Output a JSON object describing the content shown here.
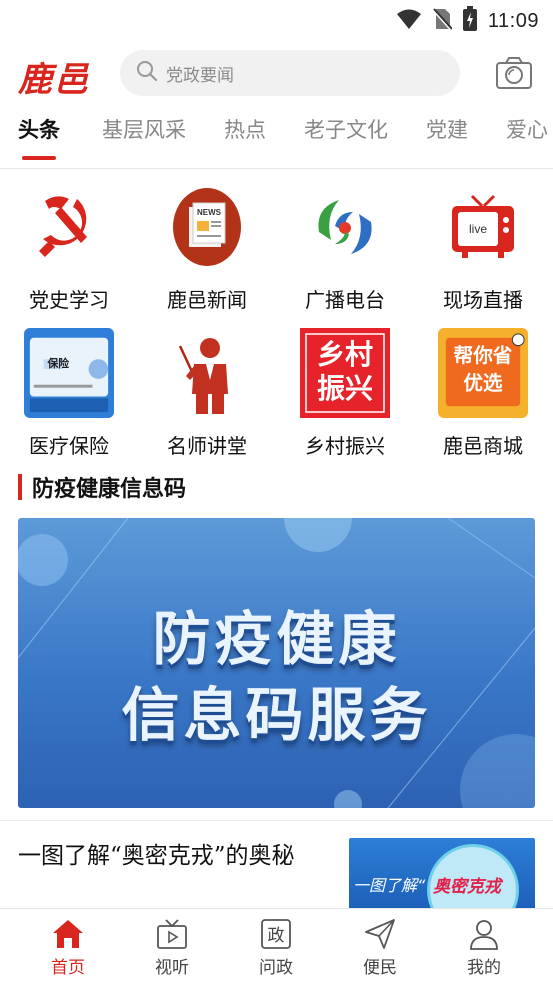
{
  "status_bar": {
    "time": "11:09"
  },
  "header": {
    "logo": "鹿邑",
    "search_placeholder": "党政要闻"
  },
  "tabs": [
    "头条",
    "基层风采",
    "热点",
    "老子文化",
    "党建",
    "爱心"
  ],
  "active_tab": "头条",
  "grid_items": [
    {
      "label": "党史学习",
      "icon": "party-emblem-icon"
    },
    {
      "label": "鹿邑新闻",
      "icon": "news-icon",
      "icon_text": "NEWS"
    },
    {
      "label": "广播电台",
      "icon": "radio-icon"
    },
    {
      "label": "现场直播",
      "icon": "live-tv-icon",
      "icon_text": "live"
    },
    {
      "label": "医疗保险",
      "icon": "medical-insurance-icon",
      "icon_text": "保险"
    },
    {
      "label": "名师讲堂",
      "icon": "teacher-icon"
    },
    {
      "label": "乡村振兴",
      "icon": "rural-revitalization-icon",
      "icon_text": "乡村振兴"
    },
    {
      "label": "鹿邑商城",
      "icon": "mall-icon",
      "icon_text": "帮你省优选"
    }
  ],
  "section": {
    "title": "防疫健康信息码"
  },
  "banner": {
    "line1": "防疫健康",
    "line2": "信息码服务"
  },
  "news": {
    "title": "一图了解“奥密克戎”的奥秘",
    "thumb_text": "一图了解“",
    "thumb_circle_text": "奥密克戎"
  },
  "bottom_nav": [
    {
      "label": "首页",
      "icon": "home-icon"
    },
    {
      "label": "视听",
      "icon": "tv-icon"
    },
    {
      "label": "问政",
      "icon": "politics-icon",
      "icon_text": "政"
    },
    {
      "label": "便民",
      "icon": "send-icon"
    },
    {
      "label": "我的",
      "icon": "user-icon"
    }
  ],
  "colors": {
    "accent": "#d8261e",
    "banner": "#3a77c7"
  }
}
